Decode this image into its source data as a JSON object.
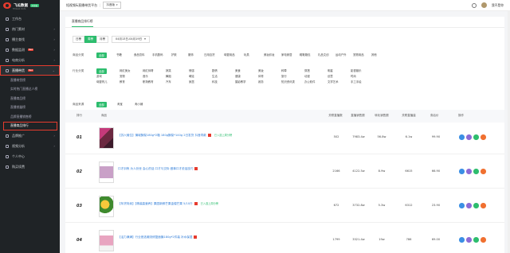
{
  "logo": {
    "name": "飞瓜数据",
    "badge": "抖音版",
    "sub": "FEIGUA DATA"
  },
  "sidebar": {
    "items": [
      {
        "label": "工作台",
        "hot": ""
      },
      {
        "label": "热门素材",
        "hot": ""
      },
      {
        "label": "播主查找",
        "hot": ""
      },
      {
        "label": "数据监测",
        "hot": "New"
      },
      {
        "label": "电商分析",
        "hot": ""
      },
      {
        "label": "直播带货",
        "hot": "New"
      }
    ],
    "sub_items": [
      "直播带货榜",
      "实时热门直播达人榜",
      "直播商品榜",
      "直播销量榜",
      "品牌直播销售榜",
      "直播商品排行"
    ],
    "bottom_items": [
      "品牌推广",
      "视频分析",
      "个人中心",
      "购买续费"
    ]
  },
  "topbar": {
    "crumb1": "短视频&直播带货平台",
    "crumb2": "抖音版",
    "username": "我不是你"
  },
  "tab": "直播商品排行榜",
  "period": {
    "options": [
      "日榜",
      "周榜",
      "月榜"
    ],
    "active": 1,
    "date": "04月13日-04月19日"
  },
  "filters": [
    {
      "label": "商品分类",
      "options": [
        "全部",
        "书籍",
        "食品饮料",
        "手机数码",
        "护肤",
        "服饰",
        "日用百货",
        "母婴用品",
        "玩具",
        "美妆彩妆",
        "家电家居",
        "鞋靴箱包",
        "礼品文创",
        "运动户外",
        "宠物用品",
        "其他"
      ]
    },
    {
      "label": "行业分类",
      "options": [
        "全部",
        "网红美女",
        "网红帅哥",
        "搞笑",
        "情感",
        "剧情",
        "美食",
        "美妆",
        "种草",
        "穿搭",
        "明星",
        "影视娱乐",
        "游戏",
        "宠物",
        "音乐",
        "舞蹈",
        "萌娃",
        "生活",
        "健康",
        "体育",
        "旅行",
        "动漫",
        "创意",
        "时尚",
        "母婴育儿",
        "教育",
        "职场教育",
        "汽车",
        "家居",
        "科技",
        "摄影教学",
        "政务",
        "知识资讯类",
        "办公软件",
        "文学艺术",
        "手工手绘"
      ]
    },
    {
      "label": "商品来源",
      "options": [
        "全部",
        "淘宝",
        "淘小铺"
      ]
    }
  ],
  "table": {
    "headers": [
      "排行",
      "商品",
      "关联直播数",
      "直播销售额",
      "转化销售额",
      "关联直播量",
      "券后价",
      "操作"
    ],
    "rows": [
      {
        "rank": "01",
        "title": "【苏六摊位】蒲城酥梨180g*2箱 180g酥梨*140g 2日发货 抖音同款",
        "tag": "已入选上周分榜",
        "c1": "502",
        "c2": "7983.4w",
        "c3": "56.8w",
        "c4": "6.1w",
        "c5": "99.90"
      },
      {
        "rank": "02",
        "title": "口才训练 为人处世 会心的话 口才与交际 做事口才说话技巧",
        "tag": "",
        "c1": "2166",
        "c2": "4122.5w",
        "c3": "8.9w",
        "c4": "6615",
        "c5": "66.90"
      },
      {
        "rank": "03",
        "title": "【年货特卖】【精装高营养】果园新鲜芒果金煌芒果 5/10斤",
        "tag": "已入选上周分榜",
        "c1": "672",
        "c2": "3732.8w",
        "c3": "5.3w",
        "c4": "6312",
        "c5": "23.90"
      },
      {
        "rank": "04",
        "title": "【活力满满】行业首选潮流修复面膜180g*2件装 补水保湿",
        "tag": "",
        "c1": "1799",
        "c2": "3321.4w",
        "c3": "19w",
        "c4": "786",
        "c5": "69.00"
      }
    ]
  },
  "colors": {
    "accent": "#2dbd6e",
    "sidebar": "#1f2326",
    "highlight": "#e63b2e",
    "link": "#2d7bd7"
  }
}
